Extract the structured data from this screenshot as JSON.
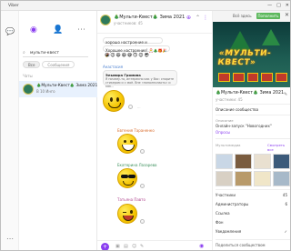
{
  "window": {
    "title": "Viber",
    "controls": [
      "—",
      "□",
      "✕"
    ]
  },
  "rail": {
    "icons": [
      "chat-icon",
      "more-icon"
    ]
  },
  "chat_list": {
    "search_value": "мульти-квест",
    "tabs": [
      {
        "label": "Все"
      },
      {
        "label": "Сообщения"
      }
    ],
    "section_label": "Чаты",
    "items": [
      {
        "name": "🎄Мульти-Квест🎄 Зима 2021",
        "sub": "В 10 Инго"
      }
    ]
  },
  "conversation": {
    "title": "🎄Мульти-Квест🎄 Зима 2021",
    "subtitle": "участников: 45",
    "messages": [
      {
        "text": "хорошо настроение и выбрала отдых!",
        "kind": "text"
      },
      {
        "text": "Хорошее настроение! 🎅🎄🎁🎉🎉",
        "kind": "text"
      },
      {
        "sender": "Анастасия",
        "quote_author": "Эльмира Громова",
        "quote_text": "Я почему-то, интересно как у Вас: спорите стикером и с моё. Вне «пополниласть» и как…",
        "kind": "sticker",
        "sticker": "smile"
      },
      {
        "sender": "Евгения Тараненко",
        "kind": "sticker",
        "sticker": "grin"
      },
      {
        "sender": "Екатерина Лазарева",
        "kind": "sticker",
        "sticker": "cool"
      },
      {
        "sender": "Татьяна Павто",
        "kind": "sticker",
        "sticker": "wink"
      }
    ]
  },
  "side_panel": {
    "top_label": "Всё здесь",
    "top_button": "Пополнить",
    "hero_text": "«МУЛЬТИ-КВЕСТ»",
    "group_name": "🎄Мульти-Квест🎄 Зима 2021",
    "group_sub": "участники: 45",
    "rows": [
      {
        "label": "Описание сообщества"
      },
      {
        "label": "Опросы"
      },
      {
        "label": "Все сообщения"
      }
    ],
    "description_label": "Описание",
    "description": "Онлайн-запуск \"Новогодних\"",
    "media_label": "Мультимедиа",
    "media_more": "Смотреть все",
    "settings": [
      {
        "key": "Участники",
        "value": "45"
      },
      {
        "key": "Администраторы",
        "value": "6"
      },
      {
        "key": "Ссылка",
        "value": ""
      },
      {
        "key": "Фон",
        "value": ""
      },
      {
        "key": "Уведомления",
        "value": "✓"
      }
    ],
    "bottom_row": "Поделиться сообществом"
  }
}
